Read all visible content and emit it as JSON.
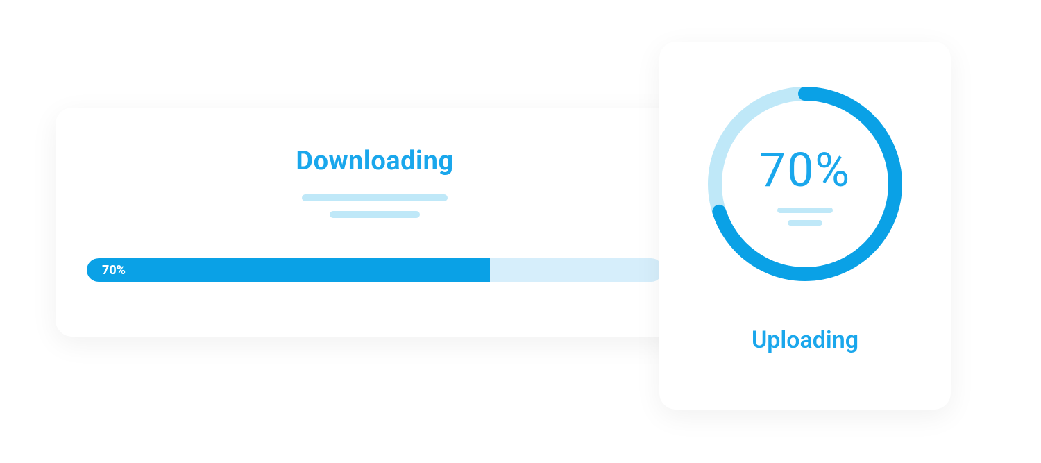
{
  "colors": {
    "accent": "#0aa1e6",
    "accent_light": "#bfe8f8",
    "track": "#d6eefb"
  },
  "download": {
    "title": "Downloading",
    "percent": 70,
    "percent_label": "70%"
  },
  "upload": {
    "title": "Uploading",
    "percent": 70,
    "percent_label": "70%"
  }
}
